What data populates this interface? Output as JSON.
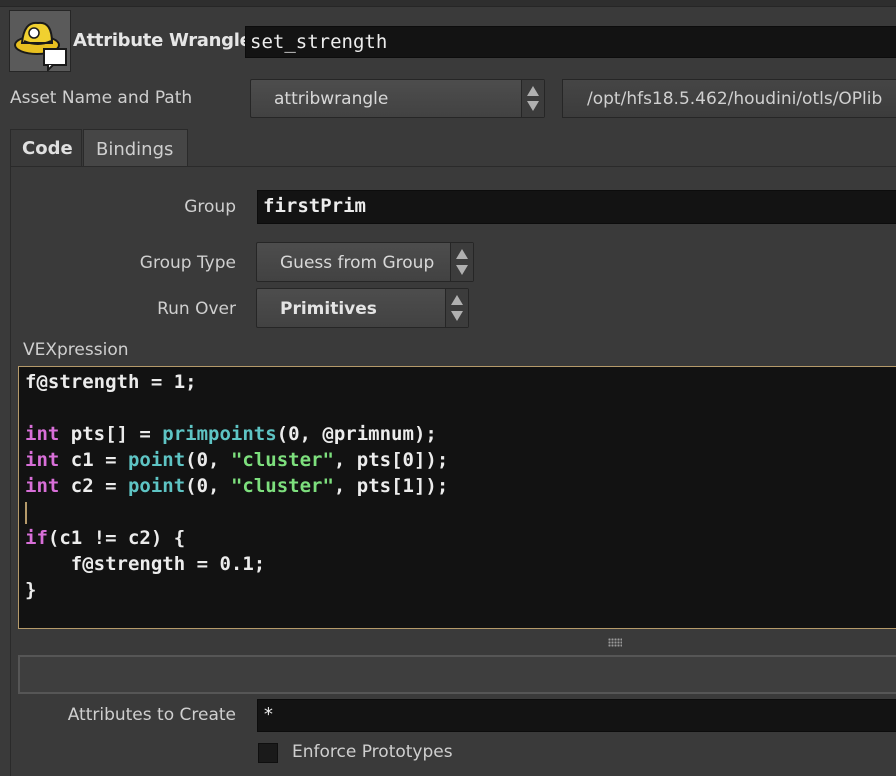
{
  "node": {
    "type_label": "Attribute Wrangle",
    "name": "set_strength",
    "icon": "wrangle-cowboy-hat-icon"
  },
  "asset": {
    "label": "Asset Name and Path",
    "name_value": "attribwrangle",
    "path_value": "/opt/hfs18.5.462/houdini/otls/OPlib"
  },
  "tabs": [
    {
      "label": "Code",
      "active": true
    },
    {
      "label": "Bindings",
      "active": false
    }
  ],
  "params": {
    "group_label": "Group",
    "group_value": "firstPrim",
    "group_type_label": "Group Type",
    "group_type_value": "Guess from Group",
    "run_over_label": "Run Over",
    "run_over_value": "Primitives",
    "vex_label": "VEXpression",
    "attrs_label": "Attributes to Create",
    "attrs_value": "*",
    "enforce_label": "Enforce Prototypes",
    "enforce_checked": false
  },
  "code": {
    "l1": "f@strength = 1;",
    "l3_kw": "int",
    "l3_a": " pts[] = ",
    "l3_fn": "primpoints",
    "l3_b": "(0, @primnum);",
    "l4_kw": "int",
    "l4_a": " c1 = ",
    "l4_fn": "point",
    "l4_b": "(0, ",
    "l4_str": "\"cluster\"",
    "l4_c": ", pts[0]);",
    "l5_kw": "int",
    "l5_a": " c2 = ",
    "l5_fn": "point",
    "l5_b": "(0, ",
    "l5_str": "\"cluster\"",
    "l5_c": ", pts[1]);",
    "l7_kw": "if",
    "l7_a": "(c1 != c2) {",
    "l8": "    f@strength = 0.1;",
    "l9": "}"
  },
  "colors": {
    "keyword": "#d86fd8",
    "function": "#5ec4c4",
    "string": "#7ddf7d",
    "editor_border": "#b59a6a"
  }
}
